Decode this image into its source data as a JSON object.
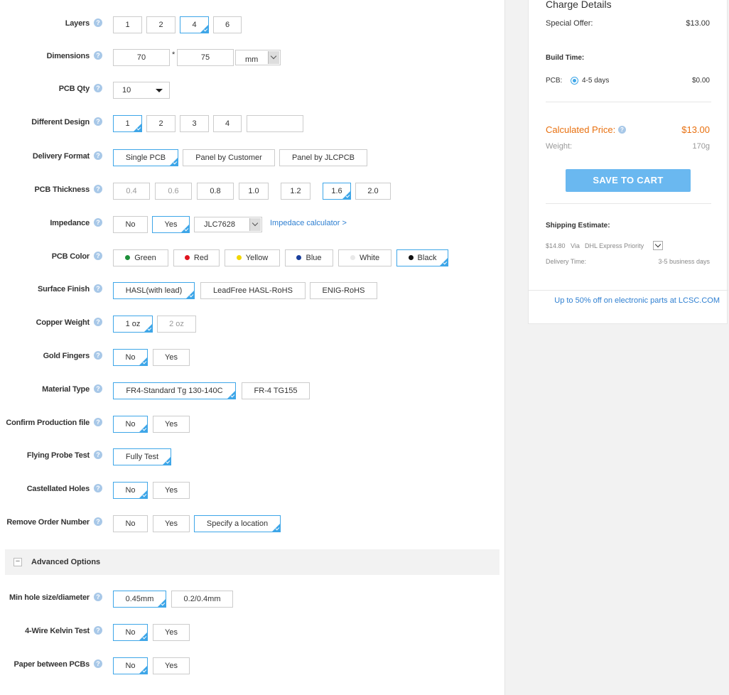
{
  "form": {
    "layers": {
      "label": "Layers",
      "options": [
        "1",
        "2",
        "4",
        "6"
      ],
      "selected": "4"
    },
    "dimensions": {
      "label": "Dimensions",
      "width": "70",
      "height": "75",
      "times": "*",
      "unit": "mm"
    },
    "pcb_qty": {
      "label": "PCB Qty",
      "value": "10"
    },
    "different_design": {
      "label": "Different Design",
      "options": [
        "1",
        "2",
        "3",
        "4"
      ],
      "selected": "1",
      "custom_value": ""
    },
    "delivery_format": {
      "label": "Delivery Format",
      "options": [
        "Single PCB",
        "Panel by Customer",
        "Panel by JLCPCB"
      ],
      "selected": "Single PCB"
    },
    "pcb_thickness": {
      "label": "PCB Thickness",
      "options": [
        "0.4",
        "0.6",
        "0.8",
        "1.0",
        "1.2",
        "1.6",
        "2.0"
      ],
      "selected": "1.6"
    },
    "impedance": {
      "label": "Impedance",
      "options": [
        "No",
        "Yes"
      ],
      "selected": "Yes",
      "stackup": "JLC7628",
      "calculator_link": "Impedace calculator >"
    },
    "pcb_color": {
      "label": "PCB Color",
      "options": [
        {
          "name": "Green",
          "color": "#1e8f3a"
        },
        {
          "name": "Red",
          "color": "#e0141e"
        },
        {
          "name": "Yellow",
          "color": "#f2d600"
        },
        {
          "name": "Blue",
          "color": "#1a3f9c"
        },
        {
          "name": "White",
          "color": "#e8e8e8"
        },
        {
          "name": "Black",
          "color": "#111111"
        }
      ],
      "selected": "Black"
    },
    "surface_finish": {
      "label": "Surface Finish",
      "options": [
        "HASL(with lead)",
        "LeadFree HASL-RoHS",
        "ENIG-RoHS"
      ],
      "selected": "HASL(with lead)"
    },
    "copper_weight": {
      "label": "Copper Weight",
      "options": [
        "1 oz",
        "2 oz"
      ],
      "selected": "1 oz"
    },
    "gold_fingers": {
      "label": "Gold Fingers",
      "options": [
        "No",
        "Yes"
      ],
      "selected": "No"
    },
    "material_type": {
      "label": "Material Type",
      "options": [
        "FR4-Standard Tg 130-140C",
        "FR-4 TG155"
      ],
      "selected": "FR4-Standard Tg 130-140C"
    },
    "confirm_production": {
      "label": "Confirm Production file",
      "options": [
        "No",
        "Yes"
      ],
      "selected": "No"
    },
    "flying_probe": {
      "label": "Flying Probe Test",
      "options": [
        "Fully Test"
      ],
      "selected": "Fully Test"
    },
    "castellated": {
      "label": "Castellated Holes",
      "options": [
        "No",
        "Yes"
      ],
      "selected": "No"
    },
    "remove_order_number": {
      "label": "Remove Order Number",
      "options": [
        "No",
        "Yes",
        "Specify a location"
      ],
      "selected": "Specify a location"
    },
    "advanced": {
      "toggle": "−",
      "label": "Advanced Options"
    },
    "min_hole": {
      "label": "Min hole size/diameter",
      "options": [
        "0.45mm",
        "0.2/0.4mm"
      ],
      "selected": "0.45mm"
    },
    "kelvin": {
      "label": "4-Wire Kelvin Test",
      "options": [
        "No",
        "Yes"
      ],
      "selected": "No"
    },
    "paper": {
      "label": "Paper between PCBs",
      "options": [
        "No",
        "Yes"
      ],
      "selected": "No"
    }
  },
  "help_glyph": "?",
  "charge": {
    "title": "Charge Details",
    "special_offer_label": "Special Offer:",
    "special_offer_value": "$13.00",
    "build_time_label": "Build Time:",
    "pcb_label": "PCB:",
    "pcb_time": "4-5 days",
    "pcb_cost": "$0.00",
    "calc_label": "Calculated Price:",
    "calc_value": "$13.00",
    "weight_label": "Weight:",
    "weight_value": "170g",
    "save_button": "SAVE TO CART",
    "ship_label": "Shipping Estimate:",
    "ship_price": "$14.80",
    "ship_via": "Via",
    "ship_method": "DHL Express Priority",
    "delivery_label": "Delivery Time:",
    "delivery_value": "3-5 business days",
    "promo": "Up to 50% off on electronic parts at LCSC.COM"
  },
  "colors": {
    "accent": "#3ea6e8",
    "price": "#e8700f",
    "button": "#6ab8f0",
    "link": "#2e7fd1"
  }
}
